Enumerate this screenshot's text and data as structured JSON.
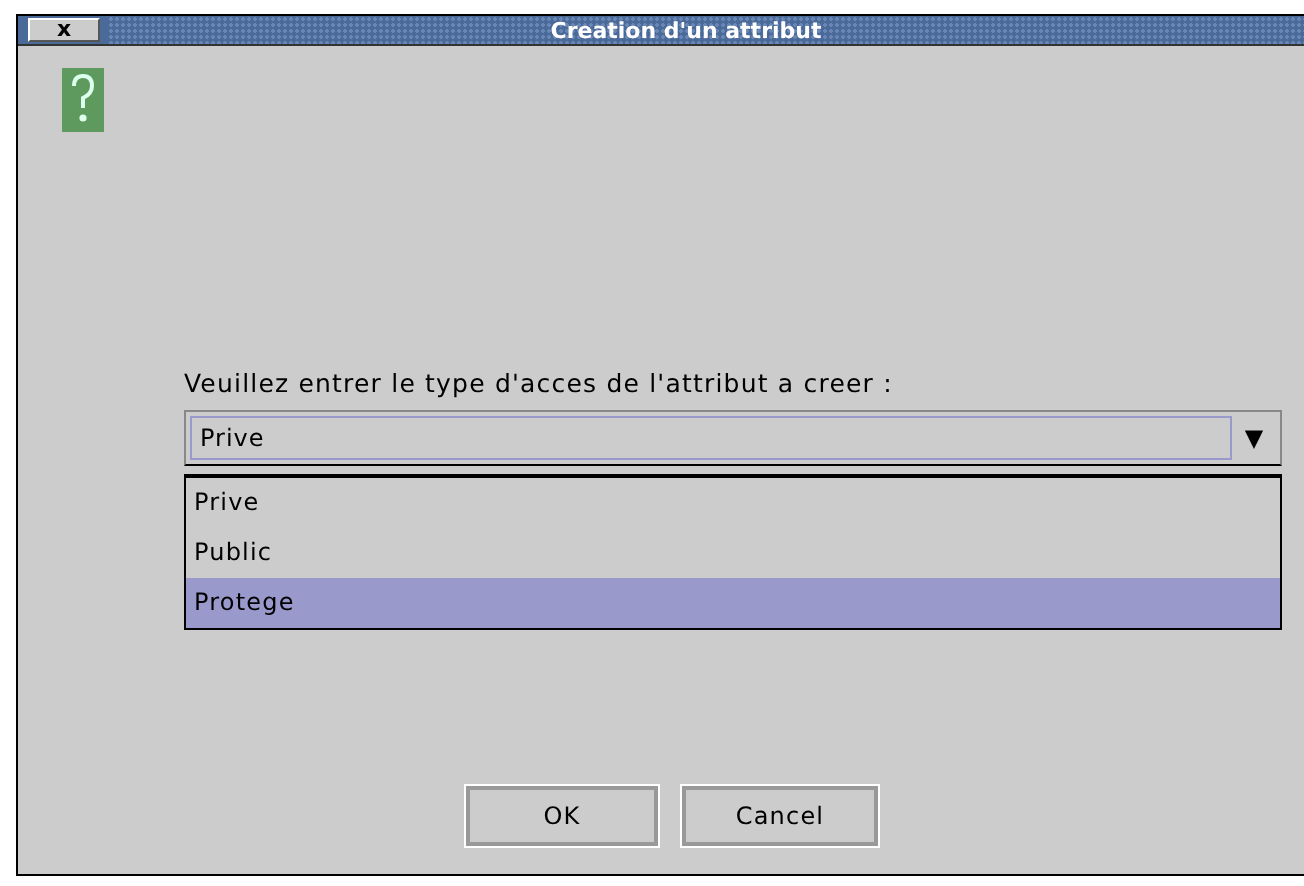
{
  "window": {
    "title": "Creation d'un attribut",
    "close_label": "x"
  },
  "prompt": "Veuillez entrer le type d'acces de l'attribut a creer :",
  "combo": {
    "value": "Prive",
    "arrow": "▼"
  },
  "dropdown": [
    {
      "label": "Prive",
      "selected": false
    },
    {
      "label": "Public",
      "selected": false
    },
    {
      "label": "Protege",
      "selected": true
    }
  ],
  "buttons": [
    {
      "label": "OK"
    },
    {
      "label": "Cancel"
    }
  ]
}
